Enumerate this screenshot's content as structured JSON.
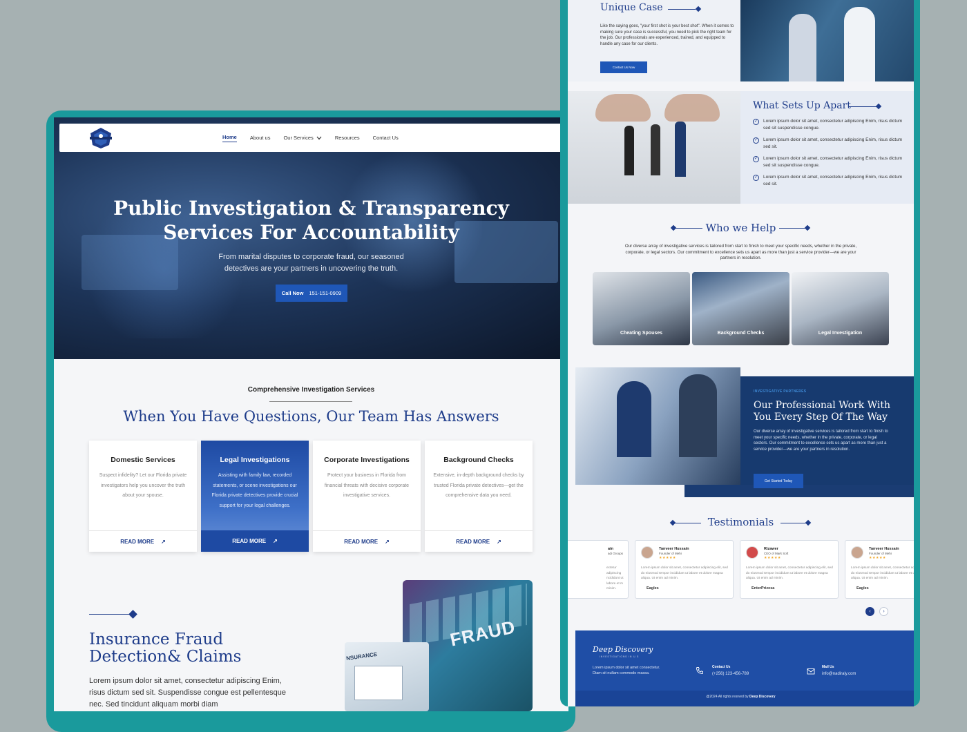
{
  "left_page": {
    "nav": {
      "items": [
        "Home",
        "About us",
        "Our Services",
        "Resources",
        "Contact Us"
      ]
    },
    "hero": {
      "title_line1": "Public Investigation & Transparency",
      "title_line2": "Services For Accountability",
      "subtitle_line1": "From marital disputes to corporate fraud, our seasoned",
      "subtitle_line2": "detectives are your partners in uncovering the truth.",
      "call_label": "Call Now",
      "call_number": "151-151-0909"
    },
    "services": {
      "eyebrow": "Comprehensive Investigation Services",
      "title": "When You Have Questions, Our Team Has Answers",
      "cards": [
        {
          "title": "Domestic Services",
          "text": "Suspect infidelity? Let our Florida private investigators help you uncover the truth about your spouse.",
          "cta": "READ MORE"
        },
        {
          "title": "Legal Investigations",
          "text": "Assisting with family law, recorded statements, or scene investigations our Florida private detectives provide crucial support for your legal challenges.",
          "cta": "READ MORE"
        },
        {
          "title": "Corporate Investigations",
          "text": "Protect your business in Florida from financial threats with decisive corporate investigative services.",
          "cta": "READ MORE"
        },
        {
          "title": "Background Checks",
          "text": "Extensive, in-depth background checks by trusted Florida private detectives—get the comprehensive data you need.",
          "cta": "READ MORE"
        }
      ]
    },
    "insurance": {
      "title": "Insurance Fraud Detection& Claims",
      "text": "Lorem ipsum dolor sit amet, consectetur adipiscing Enim, risus dictum sed sit. Suspendisse congue est pellentesque nec. Sed tincidunt aliquam morbi diam",
      "image_word": "FRAUD",
      "image2_word": "NSURANCE"
    }
  },
  "right_page": {
    "unique_case": {
      "title": "Unique Case",
      "text": "Like the saying goes, \"your first shot is your best shot\". When it comes to making sure your case is successful, you need to pick the right team for the job. Our professionals are experienced, trained, and equipped to handle any case for our clients.",
      "button": "Contact Us Now"
    },
    "sets_apart": {
      "title": "What Sets Up Apart",
      "items": [
        "Lorem ipsum dolor sit amet, consectetur adipiscing Enim, risus dictum sed sit suspendisse congue.",
        "Lorem ipsum dolor sit amet, consectetur adipiscing Enim, risus dictum sed sit.",
        "Lorem ipsum dolor sit amet, consectetur adipiscing Enim, risus dictum sed sit suspendisse congue.",
        "Lorem ipsum dolor sit amet, consectetur adipiscing Enim, risus dictum sed sit."
      ]
    },
    "who_we_help": {
      "title": "Who we Help",
      "text": "Our diverse array of investigative services is tailored from start to finish to meet your specific needs, whether in the private, corporate, or legal sectors. Our commitment to excellence sets us apart as more than just a service provider—we are your partners in resolution.",
      "cards": [
        "Cheating Spouses",
        "Background Checks",
        "Legal Investigation"
      ]
    },
    "professional": {
      "eyebrow": "INVESTIGATIVE PARTNERES",
      "title": "Our Professional Work With You Every Step Of The Way",
      "text": "Our diverse array of investigative services is tailored from start to finish to meet your specific needs, whether in the private, corporate, or legal sectors. Our commitment to excellence sets us apart as more than just a service provider—we are your partners in resolution.",
      "button": "Get Started Today"
    },
    "testimonials": {
      "title": "Testimonials",
      "cards": [
        {
          "name": "ain",
          "role": "adi Groups",
          "stars": "",
          "text": "ectetur adipiscing ncididunt ut labore et m minim.",
          "company": ""
        },
        {
          "name": "Tanveer Hussain",
          "role": "Founder of Mehi",
          "stars": "★★★★★",
          "text": "Lorem ipsum dolor sit amet, consectetur adipiscing elit, sed do eiusmod tempor incididunt ut labore et dolore magna aliqua. Ut enim ad minim.",
          "company": "Eagles"
        },
        {
          "name": "Rizawer",
          "role": "CEO of Mark Soft",
          "stars": "★★★★★",
          "text": "Lorem ipsum dolor sit amet, consectetur adipiscing elit, sed do eiusmod tempor incididunt ut labore et dolore magna aliqua. Ut enim ad minim.",
          "company": "EnterPrizesa"
        },
        {
          "name": "Tanveer Hussain",
          "role": "Founder of Mehi",
          "stars": "★★★★★",
          "text": "Lorem ipsum dolor sit amet, consectetur adipiscing elit, sed do eiusmod tempor incididunt ut labore et dolore magna aliqua. Ut enim ad minim.",
          "company": "Eagles"
        }
      ]
    },
    "footer": {
      "logo": "Deep Discovery",
      "logo_sub": "INVESTIGATIONS IN U.S",
      "desc": "Lorem ipsum dolor sit amet consectetur. Diam sit nullam commodo massa.",
      "contact_label": "Contact Us",
      "contact_value": "(+256) 123-456-789",
      "mail_label": "Mail Us",
      "mail_value": "info@nadiraly.com",
      "copyright": "@2024 All rights resrved by",
      "brand": "Deep Discovery"
    }
  }
}
